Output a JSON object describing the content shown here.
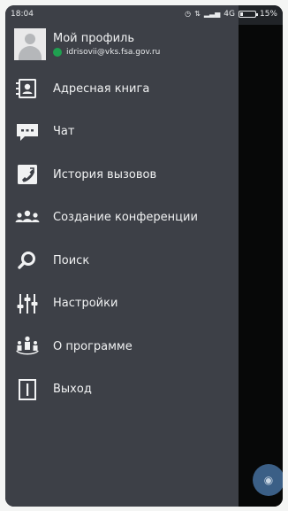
{
  "statusbar": {
    "time": "18:04",
    "network": "4G",
    "battery": "15%"
  },
  "profile": {
    "name": "Мой профиль",
    "email": "idrisovii@vks.fsa.gov.ru",
    "status_color": "#1fa050"
  },
  "menu": {
    "items": [
      {
        "label": "Адресная книга",
        "icon": "address-book-icon"
      },
      {
        "label": "Чат",
        "icon": "chat-icon"
      },
      {
        "label": "История вызовов",
        "icon": "call-history-icon"
      },
      {
        "label": "Создание конференции",
        "icon": "conference-icon"
      },
      {
        "label": "Поиск",
        "icon": "search-icon"
      },
      {
        "label": "Настройки",
        "icon": "settings-icon"
      },
      {
        "label": "О программе",
        "icon": "about-icon"
      },
      {
        "label": "Выход",
        "icon": "exit-icon"
      }
    ]
  },
  "colors": {
    "drawer_bg": "#3d4047",
    "text": "#f1f2f3",
    "fab": "#3b5f86"
  }
}
